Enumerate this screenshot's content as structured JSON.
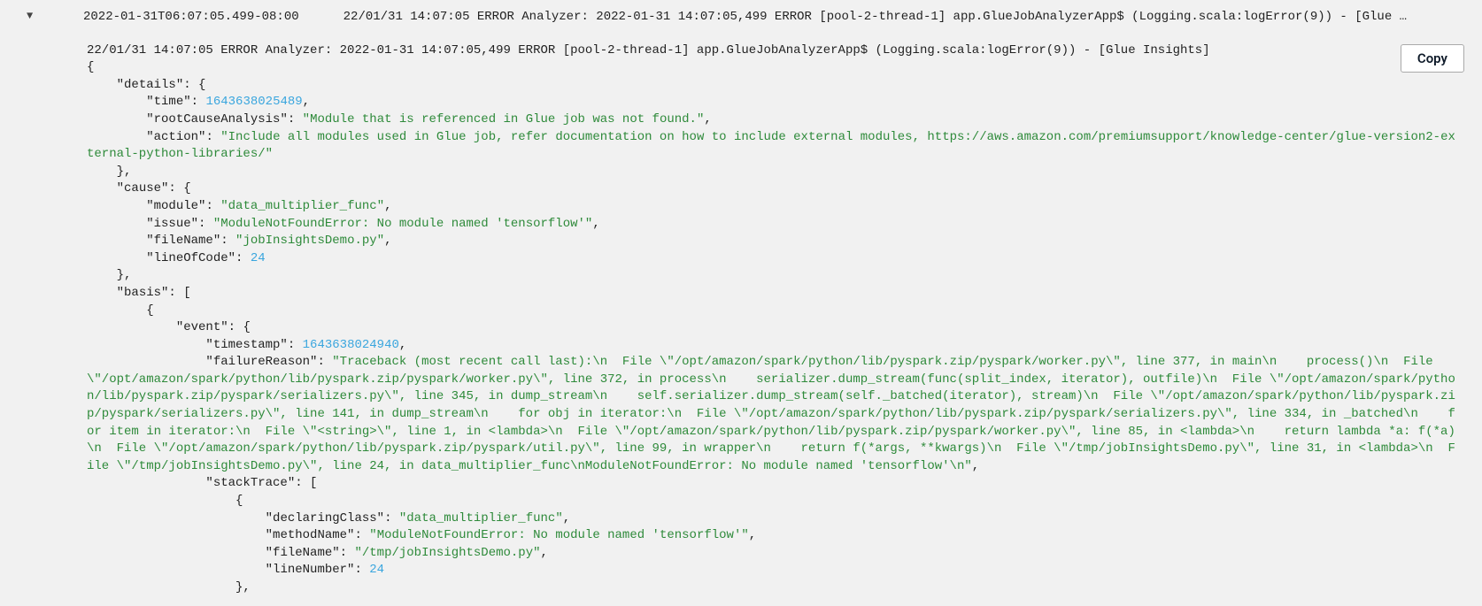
{
  "header": {
    "expand_glyph": "▼",
    "timestamp_iso": "2022-01-31T06:07:05.499-08:00",
    "summary_line": "22/01/31 14:07:05 ERROR Analyzer: 2022-01-31 14:07:05,499 ERROR [pool-2-thread-1] app.GlueJobAnalyzerApp$ (Logging.scala:logError(9)) - [Glue …"
  },
  "copy_button_label": "Copy",
  "log_prefix": "22/01/31 14:07:05 ERROR Analyzer: 2022-01-31 14:07:05,499 ERROR [pool-2-thread-1] app.GlueJobAnalyzerApp$ (Logging.scala:logError(9)) - [Glue Insights]",
  "details": {
    "time": 1643638025489,
    "rootCauseAnalysis": "Module that is referenced in Glue job was not found.",
    "action": "Include all modules used in Glue job, refer documentation on how to include external modules, https://aws.amazon.com/premiumsupport/knowledge-center/glue-version2-external-python-libraries/"
  },
  "cause": {
    "module": "data_multiplier_func",
    "issue": "ModuleNotFoundError: No module named 'tensorflow'",
    "fileName": "jobInsightsDemo.py",
    "lineOfCode": 24
  },
  "basis_event": {
    "timestamp": 1643638024940,
    "failureReason": "Traceback (most recent call last):\\n  File \\\"/opt/amazon/spark/python/lib/pyspark.zip/pyspark/worker.py\\\", line 377, in main\\n    process()\\n  File \\\"/opt/amazon/spark/python/lib/pyspark.zip/pyspark/worker.py\\\", line 372, in process\\n    serializer.dump_stream(func(split_index, iterator), outfile)\\n  File \\\"/opt/amazon/spark/python/lib/pyspark.zip/pyspark/serializers.py\\\", line 345, in dump_stream\\n    self.serializer.dump_stream(self._batched(iterator), stream)\\n  File \\\"/opt/amazon/spark/python/lib/pyspark.zip/pyspark/serializers.py\\\", line 141, in dump_stream\\n    for obj in iterator:\\n  File \\\"/opt/amazon/spark/python/lib/pyspark.zip/pyspark/serializers.py\\\", line 334, in _batched\\n    for item in iterator:\\n  File \\\"<string>\\\", line 1, in <lambda>\\n  File \\\"/opt/amazon/spark/python/lib/pyspark.zip/pyspark/worker.py\\\", line 85, in <lambda>\\n    return lambda *a: f(*a)\\n  File \\\"/opt/amazon/spark/python/lib/pyspark.zip/pyspark/util.py\\\", line 99, in wrapper\\n    return f(*args, **kwargs)\\n  File \\\"/tmp/jobInsightsDemo.py\\\", line 31, in <lambda>\\n  File \\\"/tmp/jobInsightsDemo.py\\\", line 24, in data_multiplier_func\\nModuleNotFoundError: No module named 'tensorflow'\\n",
    "stackTrace0": {
      "declaringClass": "data_multiplier_func",
      "methodName": "ModuleNotFoundError: No module named 'tensorflow'",
      "fileName": "/tmp/jobInsightsDemo.py",
      "lineNumber": 24
    }
  }
}
